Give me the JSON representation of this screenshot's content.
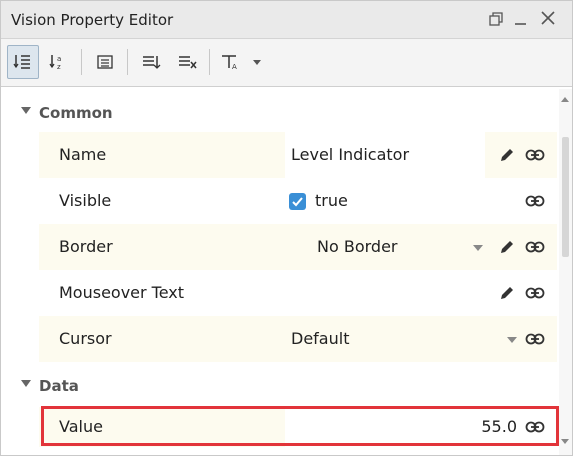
{
  "window": {
    "title": "Vision Property Editor"
  },
  "toolbar": {
    "buttons": [
      {
        "name": "sort-categorized",
        "active": true
      },
      {
        "name": "sort-alphabetical",
        "active": false
      },
      {
        "name": "property-pages",
        "active": false
      },
      {
        "name": "expand-all",
        "active": false
      },
      {
        "name": "collapse-all",
        "active": false
      },
      {
        "name": "filter",
        "active": false
      }
    ]
  },
  "categories": {
    "common": "Common",
    "data": "Data"
  },
  "properties": {
    "name": {
      "label": "Name",
      "value": "Level Indicator"
    },
    "visible": {
      "label": "Visible",
      "value": "true",
      "checked": true
    },
    "border": {
      "label": "Border",
      "value": "No Border"
    },
    "mouseover": {
      "label": "Mouseover Text",
      "value": ""
    },
    "cursor": {
      "label": "Cursor",
      "value": "Default"
    },
    "value": {
      "label": "Value",
      "value": "55.0"
    }
  },
  "colors": {
    "highlight": "#e2343a",
    "checkbox": "#3a8fd6",
    "row_alt": "#fdfbef"
  }
}
